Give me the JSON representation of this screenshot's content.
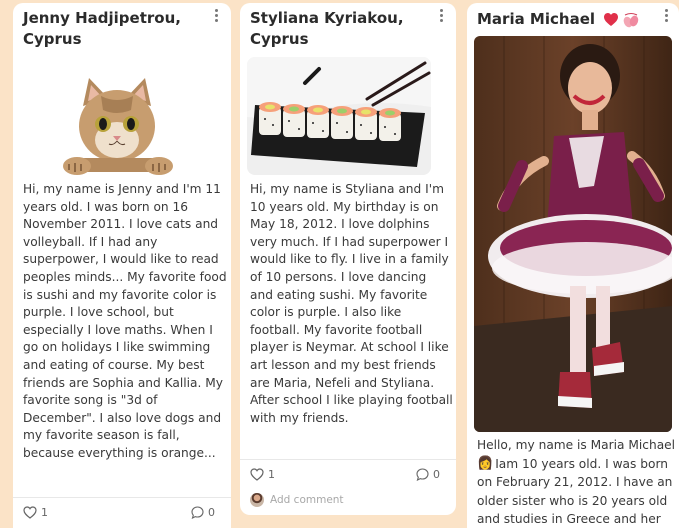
{
  "posts": [
    {
      "author": "Jenny Hadjipetrou, Cyprus",
      "image_icon": "cat-peeking-icon",
      "text": "Hi, my name is Jenny and I'm 11 years old. I was born on 16 November 2011. I love cats and volleyball. If I had any superpower, I would like to read peoples minds... My favorite food is sushi and my favorite color is purple. I love school, but especially I love maths. When I go on holidays I like swimming and eating of course. My best friends are Sophia and Kallia. My favorite song is \"3d of December\". I also love dogs and my favorite season is fall, because everything is orange...",
      "likes": "1",
      "comments": "0"
    },
    {
      "author": "Styliana Kyriakou, Cyprus",
      "image_icon": "sushi-plate-icon",
      "text": "Hi, my name is Styliana and I'm 10 years old. My birthday is on May 18, 2012. I love dolphins very much. If I had superpower I would like to fly. I live in a family of 10 persons. I love dancing and eating sushi. My favorite color is purple. I also like football. My favorite football player is Neymar. At school I like art lesson and my best friends are Maria, Nefeli and Styliana. After school I like playing football with my friends.",
      "likes": "1",
      "comments": "0",
      "add_comment": "Add comment"
    },
    {
      "author": "Maria Michael",
      "title_icons": [
        "heart-icon",
        "ballet-shoes-icon"
      ],
      "image_icon": "ballerina-photo-icon",
      "text_lines": [
        "Hello, my name is Maria Michael",
        "Iam 10 years old. I was born",
        "on February 21, 2012. I have an",
        "older sister who is 20 years old",
        "and studies in Greece and her"
      ],
      "emoji": "👩"
    }
  ],
  "colors": {
    "background": "#fbe3c7",
    "card": "#ffffff",
    "text": "#3a3a3a",
    "title": "#2b2b2b",
    "heart": "#e0304a"
  }
}
